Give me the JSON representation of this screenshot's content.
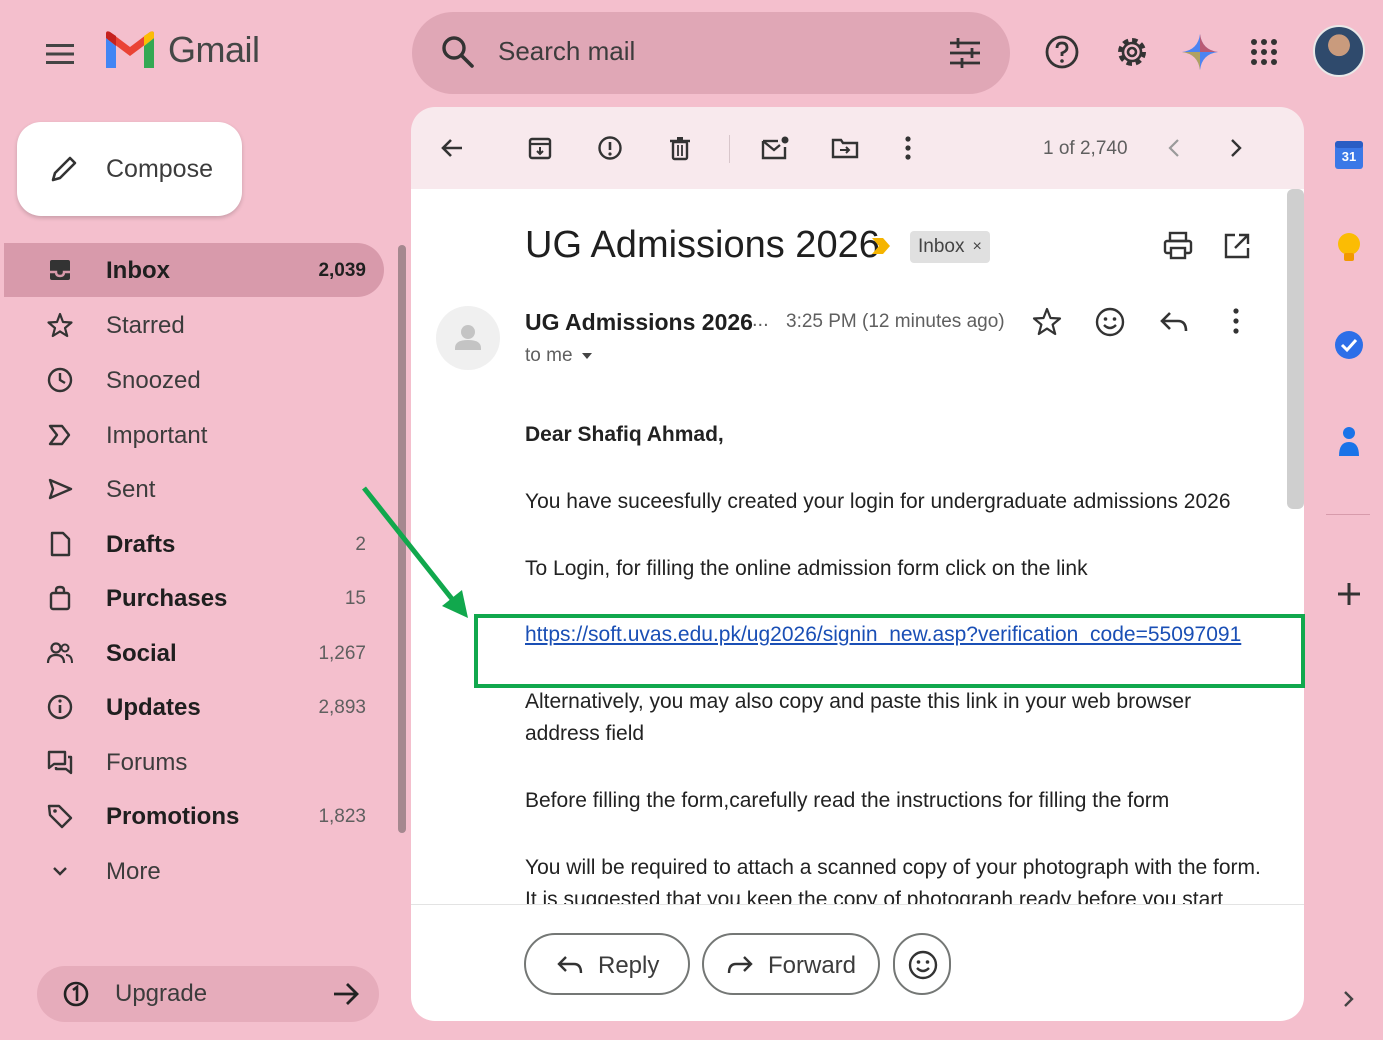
{
  "header": {
    "app_name": "Gmail",
    "search_placeholder": "Search mail"
  },
  "compose": {
    "label": "Compose"
  },
  "nav": [
    {
      "name": "Inbox",
      "count": "2,039",
      "bold": true,
      "active": true,
      "icon": "inbox-icon"
    },
    {
      "name": "Starred",
      "count": "",
      "bold": false,
      "icon": "star-icon"
    },
    {
      "name": "Snoozed",
      "count": "",
      "bold": false,
      "icon": "clock-icon"
    },
    {
      "name": "Important",
      "count": "",
      "bold": false,
      "icon": "important-icon"
    },
    {
      "name": "Sent",
      "count": "",
      "bold": false,
      "icon": "send-icon"
    },
    {
      "name": "Drafts",
      "count": "2",
      "bold": true,
      "icon": "draft-icon"
    },
    {
      "name": "Purchases",
      "count": "15",
      "bold": true,
      "icon": "shopping-bag-icon"
    },
    {
      "name": "Social",
      "count": "1,267",
      "bold": true,
      "icon": "people-icon"
    },
    {
      "name": "Updates",
      "count": "2,893",
      "bold": true,
      "icon": "info-icon"
    },
    {
      "name": "Forums",
      "count": "",
      "bold": false,
      "icon": "forum-icon"
    },
    {
      "name": "Promotions",
      "count": "1,823",
      "bold": true,
      "icon": "tag-icon"
    },
    {
      "name": "More",
      "count": "",
      "bold": false,
      "icon": "chevron-down-icon"
    }
  ],
  "upgrade": {
    "label": "Upgrade"
  },
  "toolbar": {
    "page_count": "1 of 2,740"
  },
  "email": {
    "subject": "UG Admissions 2026",
    "label_chip": "Inbox",
    "sender": "UG Admissions 2026",
    "sender_ellipsis": "...",
    "time": "3:25 PM (12 minutes ago)",
    "to": "to me",
    "greeting": "Dear Shafiq Ahmad,",
    "line1": "You have suceesfully created your login for undergraduate admissions 2026",
    "line2": "To Login, for filling the online admission form click on the link",
    "link": "https://soft.uvas.edu.pk/ug2026/signin_new.asp?verification_code=55097091",
    "line3a": "Alternatively, you may also copy and paste this link in your web browser",
    "line3b": "address field",
    "line4": "Before filling the form,carefully read the instructions for filling the form",
    "line5": "You will be required to attach a scanned copy of your photograph with the form.",
    "line6": "It is suggested that you keep the copy of photograph ready before you start"
  },
  "actions": {
    "reply": "Reply",
    "forward": "Forward"
  },
  "side_panel": {
    "calendar_day": "31"
  },
  "colors": {
    "background": "#f4bfcd",
    "highlight_box": "#11a84d",
    "annotation_arrow": "#11a84d",
    "link": "#1a4fb5"
  }
}
